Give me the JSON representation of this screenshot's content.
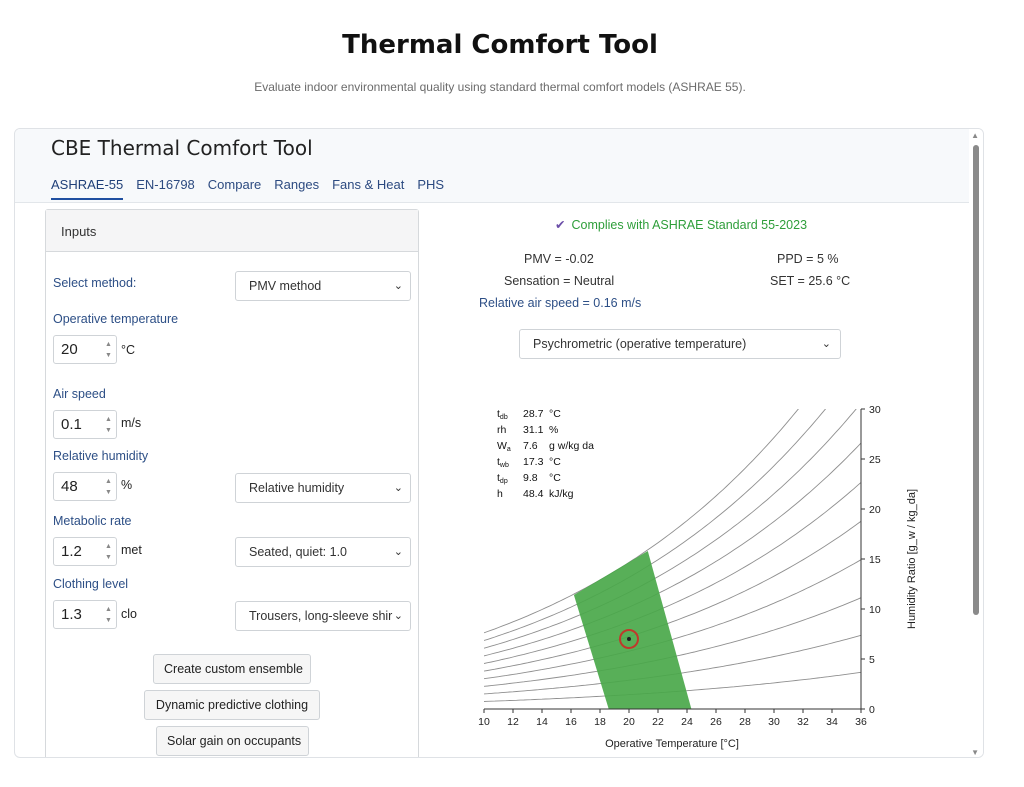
{
  "page": {
    "title": "Thermal Comfort Tool",
    "subtitle": "Evaluate indoor environmental quality using standard thermal comfort models (ASHRAE 55)."
  },
  "app": {
    "title": "CBE Thermal Comfort Tool",
    "tabs": [
      {
        "label": "ASHRAE-55",
        "active": true
      },
      {
        "label": "EN-16798",
        "active": false
      },
      {
        "label": "Compare",
        "active": false
      },
      {
        "label": "Ranges",
        "active": false
      },
      {
        "label": "Fans & Heat",
        "active": false
      },
      {
        "label": "PHS",
        "active": false
      }
    ]
  },
  "inputs": {
    "header": "Inputs",
    "method_label": "Select method:",
    "method_value": "PMV method",
    "operative_temperature": {
      "label": "Operative temperature",
      "value": "20",
      "unit": "°C"
    },
    "air_speed": {
      "label": "Air speed",
      "value": "0.1",
      "unit": "m/s"
    },
    "relative_humidity": {
      "label": "Relative humidity",
      "value": "48",
      "unit": "%",
      "select": "Relative humidity"
    },
    "metabolic_rate": {
      "label": "Metabolic rate",
      "value": "1.2",
      "unit": "met",
      "select": "Seated, quiet: 1.0"
    },
    "clothing_level": {
      "label": "Clothing level",
      "value": "1.3",
      "unit": "clo",
      "select": "Trousers, long-sleeve shir"
    },
    "buttons": {
      "custom_ensemble": "Create custom ensemble",
      "dynamic_clothing": "Dynamic predictive clothing",
      "solar_gain": "Solar gain on occupants"
    }
  },
  "results": {
    "compliance": "Complies with ASHRAE Standard 55-2023",
    "pmv": "PMV = -0.02",
    "ppd": "PPD = 5 %",
    "sensation": "Sensation = Neutral",
    "set": "SET = 25.6 °C",
    "relative_air_speed": "Relative air speed = 0.16 m/s",
    "chart_select": "Psychrometric (operative temperature)"
  },
  "chart_data": {
    "type": "scatter",
    "xlabel": "Operative Temperature [°C]",
    "ylabel": "Humidity Ratio [g_w / kg_da]",
    "xlim": [
      10,
      36
    ],
    "ylim": [
      0,
      30
    ],
    "x_ticks": [
      "10",
      "12",
      "14",
      "16",
      "18",
      "20",
      "22",
      "24",
      "26",
      "28",
      "30",
      "32",
      "34",
      "36"
    ],
    "y_ticks": [
      "0",
      "5",
      "10",
      "15",
      "20",
      "25",
      "30"
    ],
    "rh_curves_percent": [
      10,
      20,
      30,
      40,
      50,
      60,
      70,
      80,
      90,
      100
    ],
    "comfort_zone_polygon": [
      [
        18.6,
        0
      ],
      [
        24.3,
        0
      ],
      [
        21.3,
        15.8
      ],
      [
        16.2,
        11.4
      ]
    ],
    "comfort_zone_color": "#4aa84a",
    "point": {
      "x": 20,
      "y": 7.0,
      "color": "#c0392b"
    },
    "readout": [
      {
        "sym": "t",
        "sub": "db",
        "value": "28.7",
        "unit": "°C"
      },
      {
        "sym": "rh",
        "sub": "",
        "value": "31.1",
        "unit": "%"
      },
      {
        "sym": "W",
        "sub": "a",
        "value": "7.6",
        "unit": "g w/kg da"
      },
      {
        "sym": "t",
        "sub": "wb",
        "value": "17.3",
        "unit": "°C"
      },
      {
        "sym": "t",
        "sub": "dp",
        "value": "9.8",
        "unit": "°C"
      },
      {
        "sym": "h",
        "sub": "",
        "value": "48.4",
        "unit": "kJ/kg"
      }
    ]
  }
}
